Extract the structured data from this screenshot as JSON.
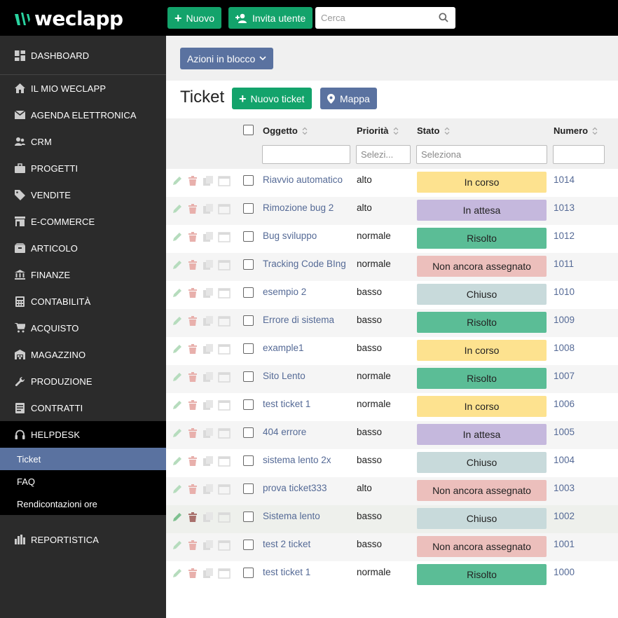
{
  "app": {
    "name": "weclapp"
  },
  "topbar": {
    "new_label": "Nuovo",
    "invite_label": "Invita utente",
    "search_placeholder": "Cerca"
  },
  "sidebar": {
    "items": [
      {
        "label": "DASHBOARD",
        "icon": "dashboard-icon"
      },
      {
        "label": "IL MIO WECLAPP",
        "icon": "home-icon"
      },
      {
        "label": "AGENDA ELETTRONICA",
        "icon": "envelope-icon"
      },
      {
        "label": "CRM",
        "icon": "contacts-icon"
      },
      {
        "label": "PROGETTI",
        "icon": "briefcase-icon"
      },
      {
        "label": "VENDITE",
        "icon": "tag-icon"
      },
      {
        "label": "E-COMMERCE",
        "icon": "shop-icon"
      },
      {
        "label": "ARTICOLO",
        "icon": "box-icon"
      },
      {
        "label": "FINANZE",
        "icon": "bank-icon"
      },
      {
        "label": "CONTABILITÀ",
        "icon": "calculator-icon"
      },
      {
        "label": "ACQUISTO",
        "icon": "cart-icon"
      },
      {
        "label": "MAGAZZINO",
        "icon": "warehouse-icon"
      },
      {
        "label": "PRODUZIONE",
        "icon": "wrench-icon"
      },
      {
        "label": "CONTRATTI",
        "icon": "contract-icon"
      },
      {
        "label": "HELPDESK",
        "icon": "headset-icon"
      }
    ],
    "helpdesk_sub": [
      {
        "label": "Ticket",
        "active": true
      },
      {
        "label": "FAQ",
        "active": false
      },
      {
        "label": "Rendicontazioni ore",
        "active": false
      }
    ],
    "reports": {
      "label": "REPORTISTICA",
      "icon": "bar-chart-icon"
    }
  },
  "main": {
    "bulk_actions_label": "Azioni in blocco",
    "title": "Ticket",
    "new_ticket_label": "Nuovo ticket",
    "map_label": "Mappa",
    "columns": {
      "subject": "Oggetto",
      "priority": "Priorità",
      "status": "Stato",
      "number": "Numero"
    },
    "filters": {
      "priority_placeholder": "Selezi...",
      "status_placeholder": "Seleziona"
    },
    "status_colors": {
      "In corso": "#fde28f",
      "In attesa": "#c5b8dd",
      "Risolto": "#5bbd96",
      "Non ancora assegnato": "#ecbfbc",
      "Chiuso": "#c8dadb"
    },
    "rows": [
      {
        "subject": "Riavvio automatico",
        "priority": "alto",
        "status": "In corso",
        "number": "1014"
      },
      {
        "subject": "Rimozione bug 2",
        "priority": "alto",
        "status": "In attesa",
        "number": "1013"
      },
      {
        "subject": "Bug sviluppo",
        "priority": "normale",
        "status": "Risolto",
        "number": "1012"
      },
      {
        "subject": "Tracking Code BIng",
        "priority": "normale",
        "status": "Non ancora assegnato",
        "number": "1011"
      },
      {
        "subject": "esempio 2",
        "priority": "basso",
        "status": "Chiuso",
        "number": "1010"
      },
      {
        "subject": "Errore di sistema",
        "priority": "basso",
        "status": "Risolto",
        "number": "1009"
      },
      {
        "subject": "example1",
        "priority": "basso",
        "status": "In corso",
        "number": "1008"
      },
      {
        "subject": "Sito Lento",
        "priority": "normale",
        "status": "Risolto",
        "number": "1007"
      },
      {
        "subject": "test ticket 1",
        "priority": "normale",
        "status": "In corso",
        "number": "1006"
      },
      {
        "subject": "404 errore",
        "priority": "basso",
        "status": "In attesa",
        "number": "1005"
      },
      {
        "subject": "sistema lento 2x",
        "priority": "basso",
        "status": "Chiuso",
        "number": "1004"
      },
      {
        "subject": "prova ticket333",
        "priority": "alto",
        "status": "Non ancora assegnato",
        "number": "1003"
      },
      {
        "subject": "Sistema lento",
        "priority": "basso",
        "status": "Chiuso",
        "number": "1002"
      },
      {
        "subject": "test 2 ticket",
        "priority": "basso",
        "status": "Non ancora assegnato",
        "number": "1001"
      },
      {
        "subject": "test ticket 1",
        "priority": "normale",
        "status": "Risolto",
        "number": "1000"
      }
    ]
  }
}
